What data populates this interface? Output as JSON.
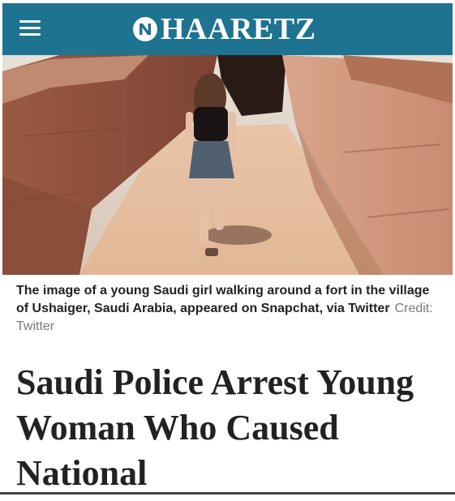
{
  "header": {
    "logo_text": "HAARETZ",
    "bar_color": "#1d7390",
    "menu_icon": "hamburger-menu-icon"
  },
  "photo": {
    "subject": "young woman walking through a narrow mud-walled passage"
  },
  "caption": {
    "text": "The image of a young Saudi girl walking around a fort in the village of Ushaiger, Saudi Arabia, appeared on Snapchat, via Twitter",
    "credit": "Credit: Twitter"
  },
  "article": {
    "headline": "Saudi Police Arrest Young Woman Who Caused National"
  }
}
